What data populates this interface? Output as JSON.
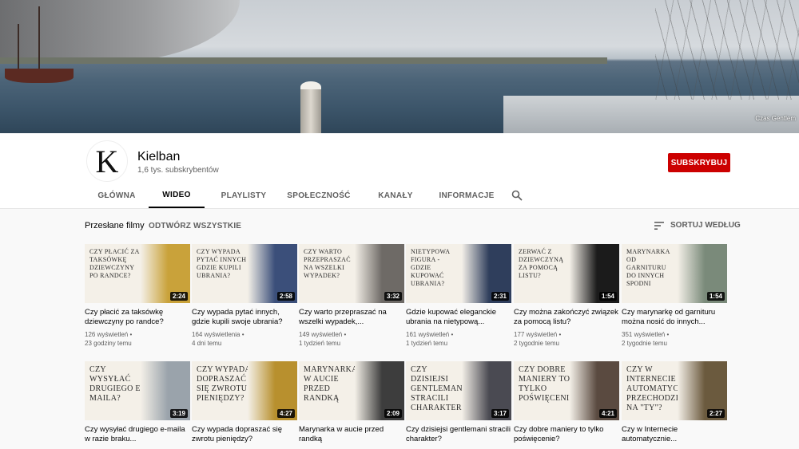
{
  "banner": {
    "credit": "Czas Gentlem"
  },
  "channel": {
    "avatar_letter": "K",
    "name": "Kielban",
    "subscribers": "1,6 tys. subskrybentów",
    "subscribe_label": "SUBSKRYBUJ"
  },
  "tabs": [
    "GŁÓWNA",
    "WIDEO",
    "PLAYLISTY",
    "SPOŁECZNOŚĆ",
    "KANAŁY",
    "INFORMACJE"
  ],
  "active_tab": "WIDEO",
  "section": {
    "title": "Przesłane filmy",
    "play_all": "ODTWÓRZ WSZYSTKIE",
    "sort_label": "SORTUJ WEDŁUG"
  },
  "videos": [
    {
      "thumb_text": "Czy płacić za taksówkę dziewczyny po randce?",
      "duration": "2:24",
      "title": "Czy płacić za taksówkę dziewczyny po randce?",
      "views": "126 wyświetleń",
      "age": "23 godziny temu",
      "accent": "#c9a23a"
    },
    {
      "thumb_text": "Czy wypada pytać innych gdzie kupili ubrania?",
      "duration": "2:58",
      "title": "Czy wypada pytać innych, gdzie kupili swoje ubrania?",
      "views": "164 wyświetlenia",
      "age": "4 dni temu",
      "accent": "#3b4f7a"
    },
    {
      "thumb_text": "Czy warto przepraszać na wszelki wypadek?",
      "duration": "3:32",
      "title": "Czy warto przepraszać na wszelki wypadek,...",
      "views": "149 wyświetleń",
      "age": "1 tydzień temu",
      "accent": "#6e6a66"
    },
    {
      "thumb_text": "Nietypowa figura - gdzie kupować ubrania?",
      "duration": "2:31",
      "title": "Gdzie kupować eleganckie ubrania na nietypową...",
      "views": "161 wyświetleń",
      "age": "1 tydzień temu",
      "accent": "#2f3e5c"
    },
    {
      "thumb_text": "Zerwać z dziewczyną za pomocą listu?",
      "duration": "1:54",
      "title": "Czy można zakończyć związek za pomocą listu?",
      "views": "177 wyświetleń",
      "age": "2 tygodnie temu",
      "accent": "#1b1b1b"
    },
    {
      "thumb_text": "Marynarka od garnituru do innych spodni",
      "duration": "1:54",
      "title": "Czy marynarkę od garnituru można nosić do innych...",
      "views": "351 wyświetleń",
      "age": "2 tygodnie temu",
      "accent": "#7a8a7a"
    },
    {
      "thumb_text": "Czy wysyłać drugiego e-maila?",
      "duration": "3:19",
      "title": "Czy wysyłać drugiego e-maila w razie braku...",
      "views": "",
      "age": "",
      "accent": "#9aa3ab"
    },
    {
      "thumb_text": "Czy wypada dopraszać się zwrotu pieniędzy?",
      "duration": "4:27",
      "title": "Czy wypada dopraszać się zwrotu pieniędzy?",
      "views": "",
      "age": "",
      "accent": "#b8902e"
    },
    {
      "thumb_text": "Marynarka w aucie przed randką",
      "duration": "2:09",
      "title": "Marynarka w aucie przed randką",
      "views": "",
      "age": "",
      "accent": "#3d3d3d"
    },
    {
      "thumb_text": "Czy dzisiejsi gentlemani stracili charakter?",
      "duration": "3:17",
      "title": "Czy dzisiejsi gentlemani stracili charakter?",
      "views": "",
      "age": "",
      "accent": "#4a4a52"
    },
    {
      "thumb_text": "Czy dobre maniery to tylko poświęcenie?",
      "duration": "4:21",
      "title": "Czy dobre maniery to tylko poświęcenie?",
      "views": "",
      "age": "",
      "accent": "#5a4a40"
    },
    {
      "thumb_text": "Czy w Internecie automatycznie przechodzimy na \"Ty\"?",
      "duration": "2:27",
      "title": "Czy w Internecie automatycznie...",
      "views": "",
      "age": "",
      "accent": "#6b5a3e"
    }
  ]
}
